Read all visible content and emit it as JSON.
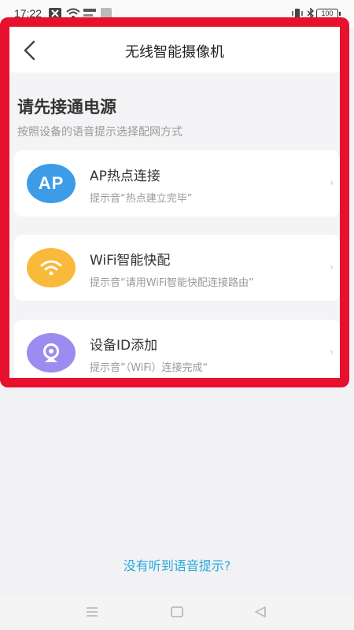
{
  "status_bar": {
    "time": "17:22",
    "battery": "100"
  },
  "nav": {
    "title": "无线智能摄像机"
  },
  "intro": {
    "heading": "请先接通电源",
    "subheading": "按照设备的语音提示选择配网方式"
  },
  "options": [
    {
      "title": "AP热点连接",
      "subtitle": "提示音“热点建立完毕”",
      "icon": "ap-hotspot-icon",
      "icon_text": "AP",
      "color": "#3d9ce8"
    },
    {
      "title": "WiFi智能快配",
      "subtitle": "提示音“请用WiFi智能快配连接路由”",
      "icon": "wifi-icon",
      "color": "#f9b93a"
    },
    {
      "title": "设备ID添加",
      "subtitle": "提示音”（WiFi）连接完成“",
      "icon": "camera-icon",
      "color": "#9c8cf0"
    }
  ],
  "footer": {
    "help_link": "没有听到语音提示?"
  },
  "colors": {
    "frame": "#e8112d",
    "link": "#2aa8e0"
  }
}
